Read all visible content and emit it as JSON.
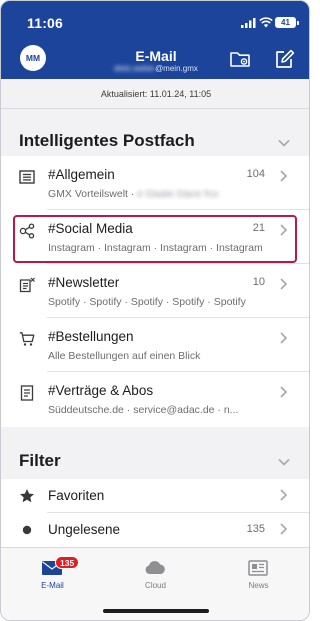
{
  "status_bar": {
    "time": "11:06",
    "battery": "41"
  },
  "header": {
    "avatar_initials": "MM",
    "title": "E-Mail",
    "account": "@mein.gmx",
    "account_blurred": "dietz.weber"
  },
  "updated_text": "Aktualisiert: 11.01.24, 11:05",
  "smart_inbox": {
    "title": "Intelligentes Postfach",
    "items": [
      {
        "title": "#Allgemein",
        "count": "104",
        "subtitle": "GMX Vorteilswelt · ",
        "subtitle_blurred": "e Daate Dace fco"
      },
      {
        "title": "#Social Media",
        "count": "21",
        "subtitle": "Instagram · Instagram · Instagram · Instagram"
      },
      {
        "title": "#Newsletter",
        "count": "10",
        "subtitle": "Spotify · Spotify · Spotify · Spotify · Spotify"
      },
      {
        "title": "#Bestellungen",
        "count": "",
        "subtitle": "Alle Bestellungen auf einen Blick"
      },
      {
        "title": "#Verträge & Abos",
        "count": "",
        "subtitle": "Süddeutsche.de · service@adac.de · n..."
      }
    ]
  },
  "filter": {
    "title": "Filter",
    "items": [
      {
        "title": "Favoriten",
        "count": ""
      },
      {
        "title": "Ungelesene",
        "count": "135"
      }
    ]
  },
  "tabbar": {
    "tabs": [
      {
        "label": "E-Mail",
        "badge": "135"
      },
      {
        "label": "Cloud"
      },
      {
        "label": "News"
      }
    ]
  },
  "colors": {
    "brand": "#1c449b",
    "highlight": "#b8174f",
    "badge": "#e0201f"
  }
}
